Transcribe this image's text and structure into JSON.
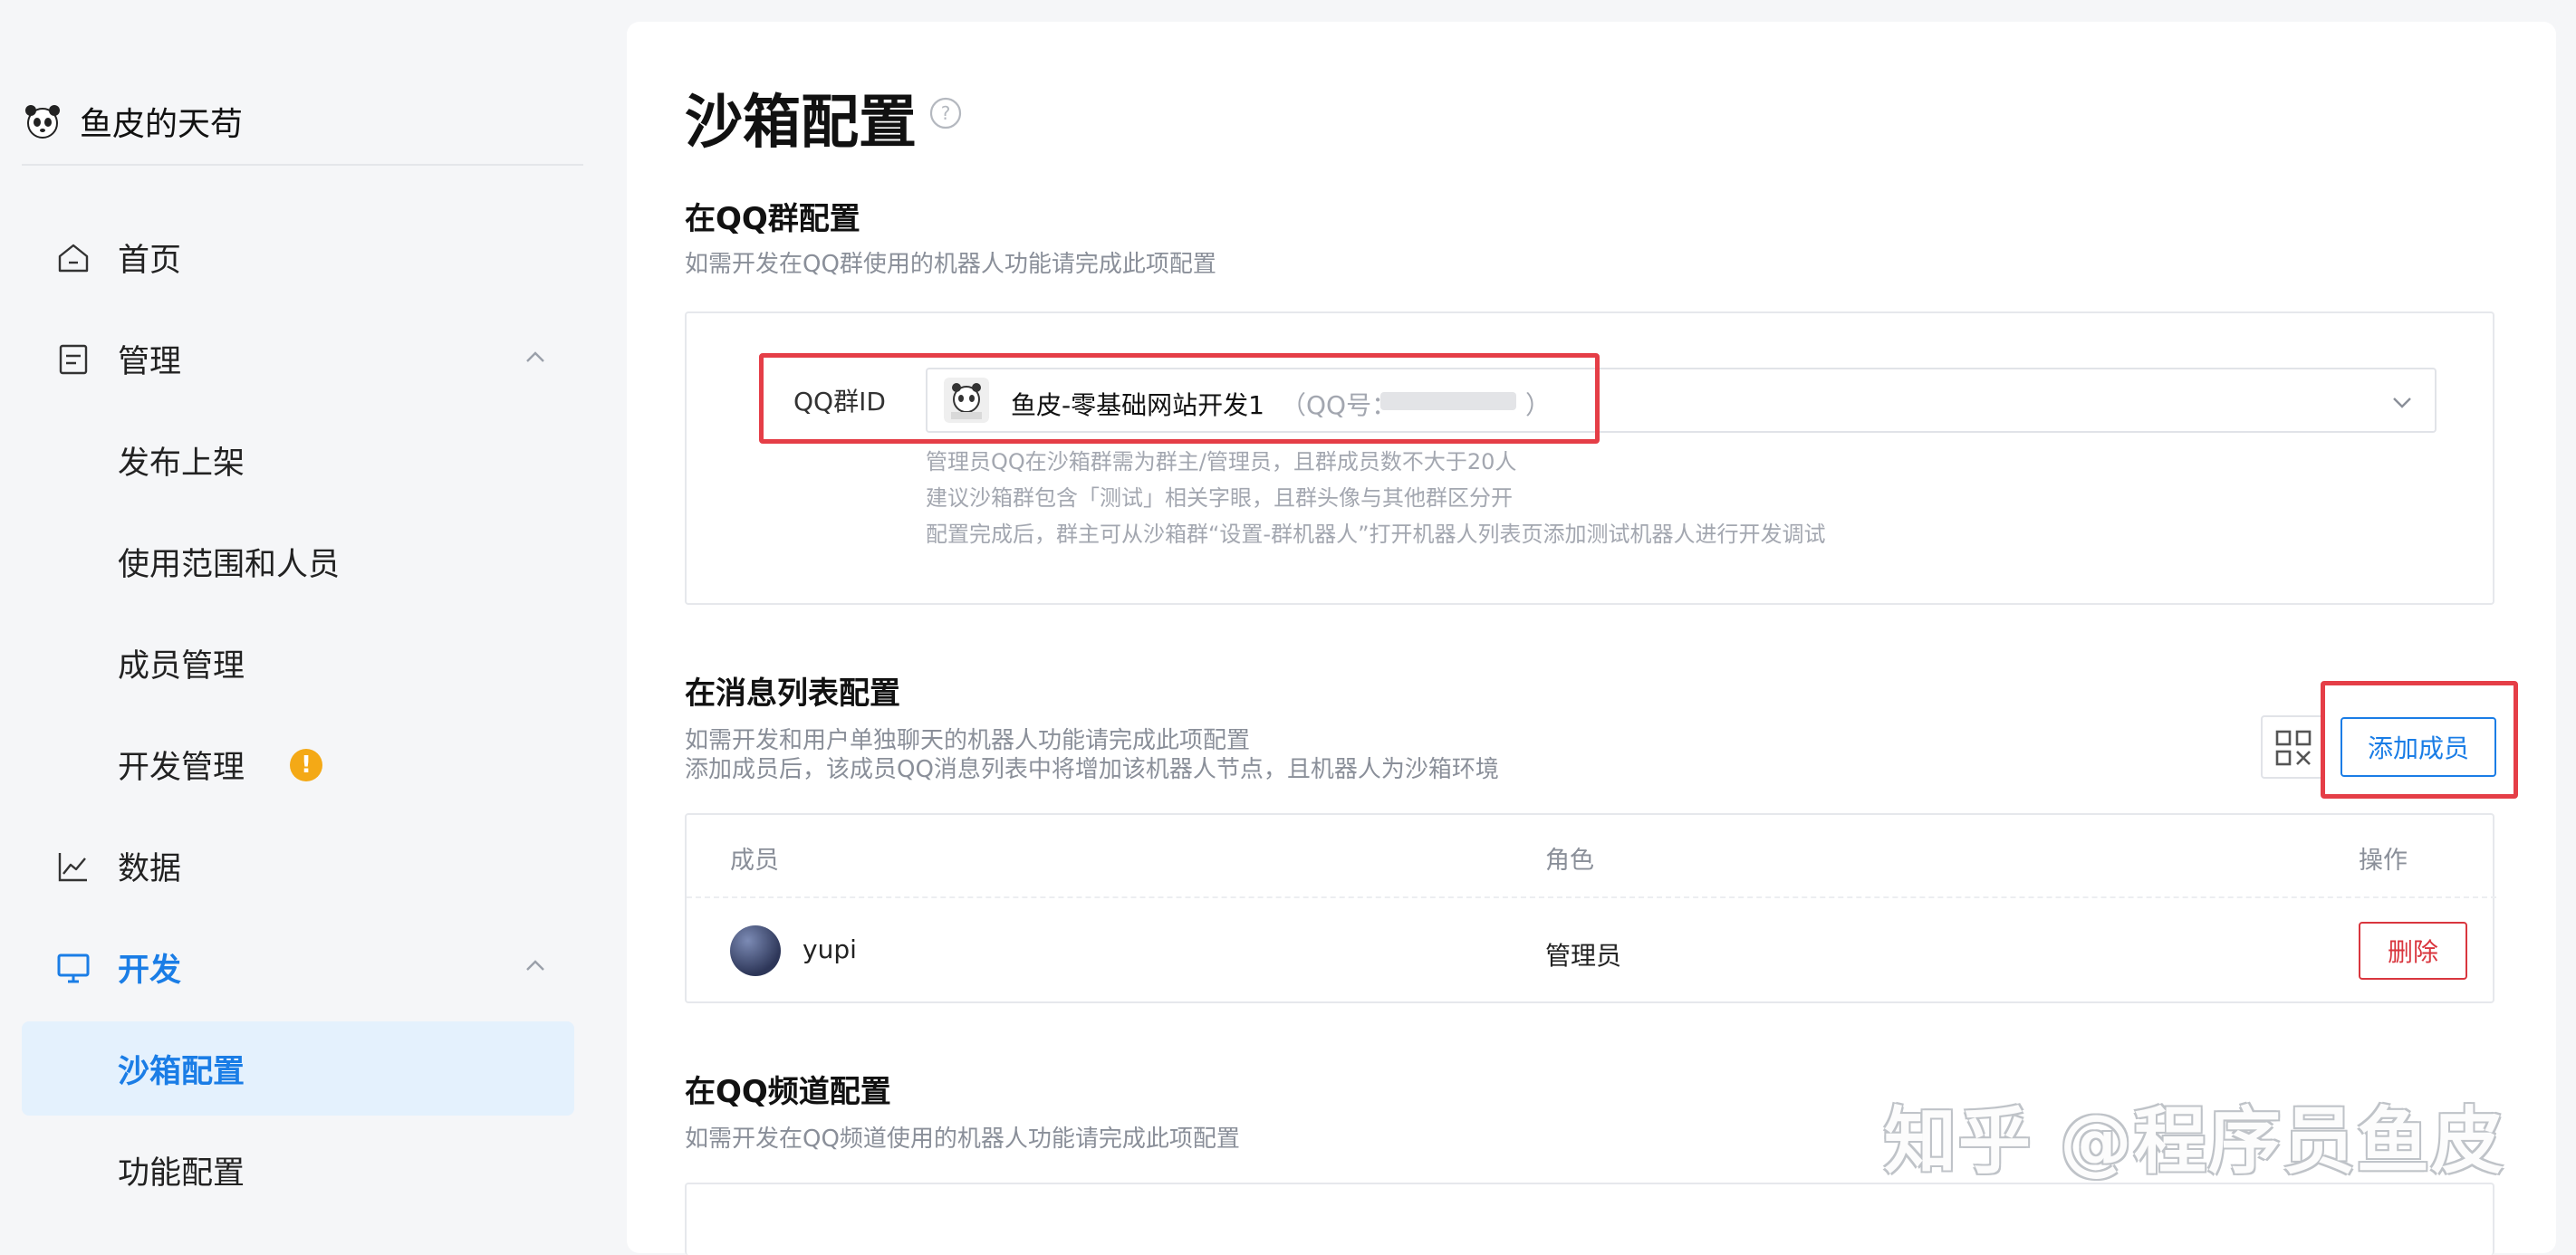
{
  "sidebar": {
    "brand_name": "鱼皮的天苟",
    "items": [
      {
        "label": "首页",
        "icon": "home-icon"
      },
      {
        "label": "管理",
        "icon": "document-icon"
      },
      {
        "label": "发布上架"
      },
      {
        "label": "使用范围和人员"
      },
      {
        "label": "成员管理"
      },
      {
        "label": "开发管理",
        "badge": "!"
      },
      {
        "label": "数据",
        "icon": "chart-icon"
      },
      {
        "label": "开发",
        "icon": "monitor-icon"
      },
      {
        "label": "沙箱配置"
      },
      {
        "label": "功能配置"
      }
    ]
  },
  "main": {
    "title": "沙箱配置",
    "qq_group": {
      "title": "在QQ群配置",
      "desc": "如需开发在QQ群使用的机器人功能请完成此项配置",
      "field_label": "QQ群ID",
      "selected_name": "鱼皮-零基础网站开发1",
      "selected_meta": "（QQ号：",
      "selected_close": "）",
      "hints": [
        "管理员QQ在沙箱群需为群主/管理员，且群成员数不大于20人",
        "建议沙箱群包含「测试」相关字眼，且群头像与其他群区分开",
        "配置完成后，群主可从沙箱群“设置-群机器人”打开机器人列表页添加测试机器人进行开发调试"
      ]
    },
    "msg_list": {
      "title": "在消息列表配置",
      "desc1": "如需开发和用户单独聊天的机器人功能请完成此项配置",
      "desc2": "添加成员后，该成员QQ消息列表中将增加该机器人节点，且机器人为沙箱环境",
      "add_button": "添加成员",
      "columns": [
        "成员",
        "角色",
        "操作"
      ],
      "rows": [
        {
          "name": "yupi",
          "role": "管理员",
          "action": "删除"
        }
      ]
    },
    "channel": {
      "title": "在QQ频道配置",
      "desc": "如需开发在QQ频道使用的机器人功能请完成此项配置"
    }
  },
  "watermark": "知乎 @程序员鱼皮",
  "colors": {
    "accent": "#1a7de6",
    "danger": "#d9363e",
    "highlight_frame": "#e53e47",
    "warning": "#f4a916"
  }
}
